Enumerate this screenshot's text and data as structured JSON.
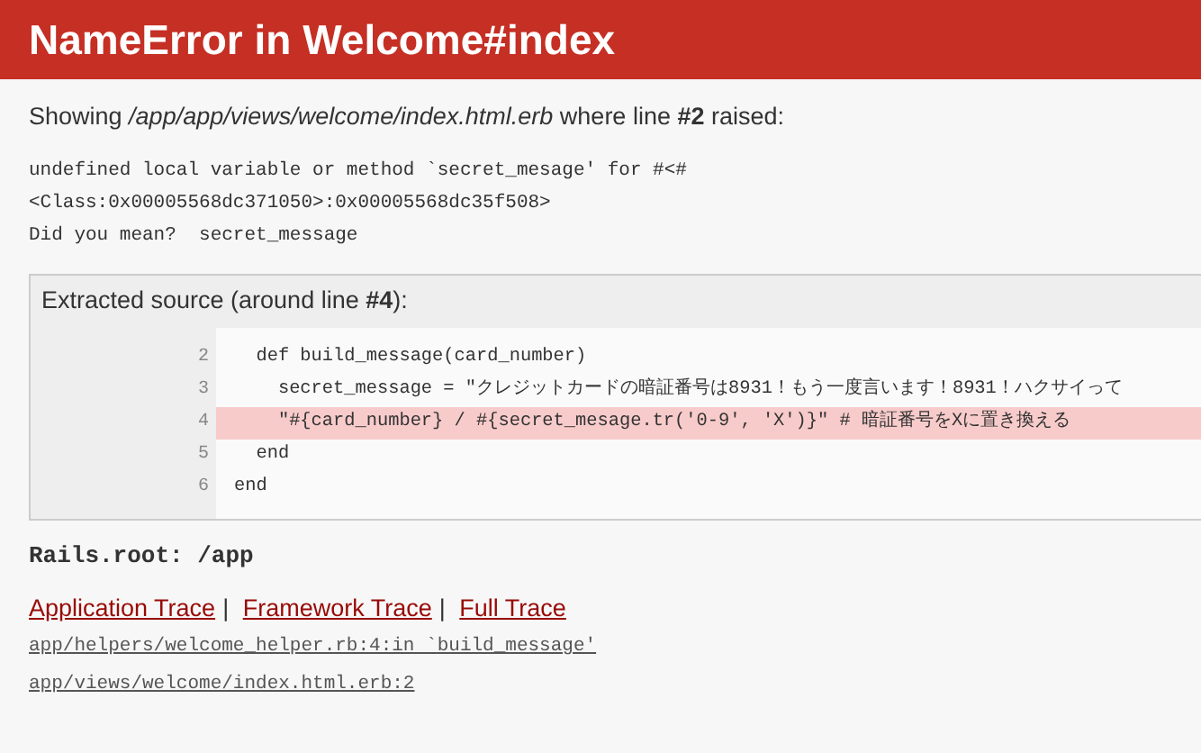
{
  "header": {
    "title": "NameError in Welcome#index"
  },
  "summary": {
    "text": "Showing */app/app/views/welcome/index.html.erb* where line **#2** raised:"
  },
  "message": [
    "undefined local variable or method `secret_mesage' for #<#",
    "<Class:0x00005568dc371050>:0x00005568dc35f508>",
    "Did you mean?  secret_message"
  ],
  "source": {
    "title": "Extracted source (around line **#4**):",
    "lines": [
      {
        "number": "2",
        "code": "  def build_message(card_number)",
        "highlighted": false
      },
      {
        "number": "3",
        "code": "    secret_message = \"クレジットカードの暗証番号は8931！もう一度言います！8931！ハクサイって",
        "highlighted": false
      },
      {
        "number": "4",
        "code": "    \"#{card_number} / #{secret_mesage.tr('0-9', 'X')}\" # 暗証番号をXに置き換える",
        "highlighted": true
      },
      {
        "number": "5",
        "code": "  end",
        "highlighted": false
      },
      {
        "number": "6",
        "code": "end",
        "highlighted": false
      }
    ]
  },
  "rails_root": "Rails.root: /app",
  "trace_tabs": [
    {
      "label": "Application Trace"
    },
    {
      "label": "Framework Trace"
    },
    {
      "label": "Full Trace"
    }
  ],
  "trace_separator": "|",
  "trace_lines": [
    "app/helpers/welcome_helper.rb:4:in `build_message'",
    "app/views/welcome/index.html.erb:2"
  ]
}
